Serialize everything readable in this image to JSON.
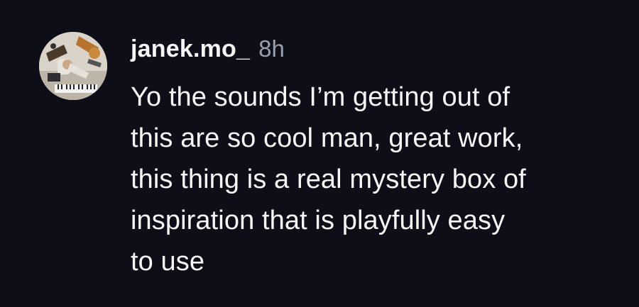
{
  "comment": {
    "author": {
      "username": "janek.mo_",
      "avatar_icon": "studio-photo-avatar"
    },
    "time_ago": "8h",
    "text_lines": [
      "Yo the sounds I’m getting out of",
      "this are so cool man, great work,",
      "this thing is a real mystery box of",
      "inspiration that is playfully easy",
      "to use"
    ]
  },
  "colors": {
    "background": "#0d0e17",
    "text": "#f5f5f5",
    "muted": "#9aa0ad"
  }
}
